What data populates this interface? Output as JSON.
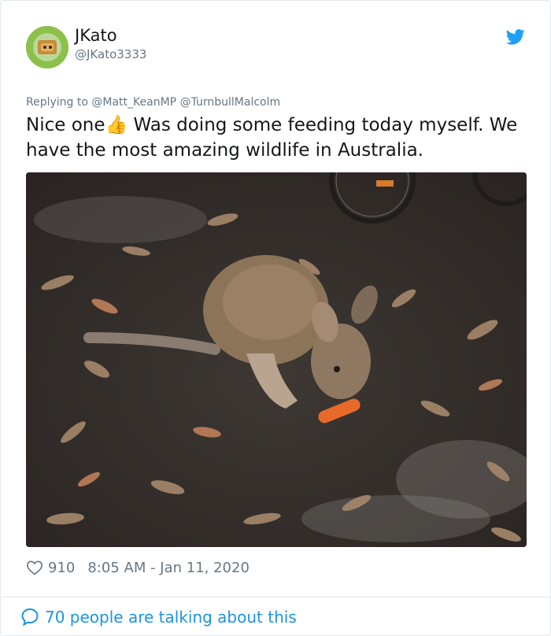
{
  "tweet": {
    "user": {
      "name": "JKato",
      "handle": "@JKato3333",
      "avatar_icon": "avatar-icon",
      "avatar_bg": "#8cc04b"
    },
    "platform_icon": "twitter-bird-icon",
    "accent_color": "#1da1f2",
    "replying_prefix": "Replying to",
    "replying_to": [
      "@Matt_KeanMP",
      "@TurnbullMalcolm"
    ],
    "text_before_emoji": "Nice one",
    "emoji": "👍",
    "text_after_emoji": " Was doing some feeding today myself. We have the most amazing wildlife in Australia.",
    "photo": {
      "subject": "wallaby eating a carrot among dry leaves"
    },
    "likes": "910",
    "timestamp": "8:05 AM - Jan 11, 2020",
    "talking": "70 people are talking about this"
  }
}
